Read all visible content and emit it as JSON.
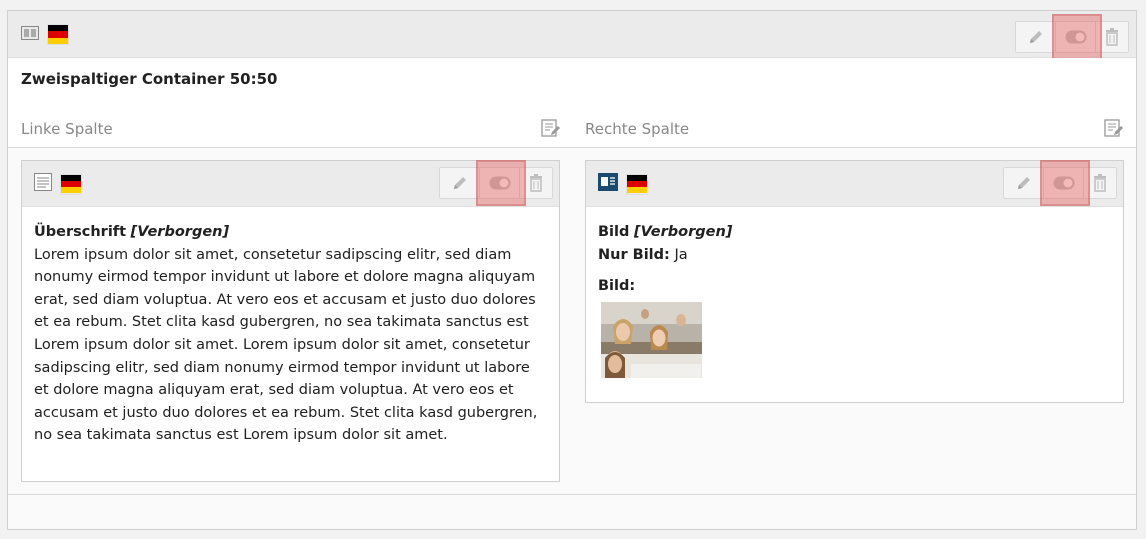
{
  "container": {
    "title": "Zweispaltiger Container 50:50",
    "left_column_label": "Linke Spalte",
    "right_column_label": "Rechte Spalte"
  },
  "left_element": {
    "heading": "Überschrift",
    "hidden_tag": "[Verborgen]",
    "text": "Lorem ipsum dolor sit amet, consetetur sadipscing elitr, sed diam nonumy eirmod tempor invidunt ut labore et dolore magna aliquyam erat, sed diam voluptua. At vero eos et accusam et justo duo dolores et ea rebum. Stet clita kasd gubergren, no sea takimata sanctus est Lorem ipsum dolor sit amet. Lorem ipsum dolor sit amet, consetetur sadipscing elitr, sed diam nonumy eirmod tempor invidunt ut labore et dolore magna aliquyam erat, sed diam voluptua. At vero eos et accusam et justo duo dolores et ea rebum. Stet clita kasd gubergren, no sea takimata sanctus est Lorem ipsum dolor sit amet."
  },
  "right_element": {
    "heading": "Bild",
    "hidden_tag": "[Verborgen]",
    "only_image_label": "Nur Bild:",
    "only_image_value": "Ja",
    "image_label": "Bild:"
  },
  "icons": {
    "container": "grid-container-icon",
    "language": "german-flag-icon",
    "edit": "pencil-icon",
    "toggle": "toggle-visibility-icon",
    "delete": "trash-icon",
    "column_edit": "edit-column-icon",
    "text_element": "text-content-icon",
    "image_element": "text-image-content-icon"
  },
  "colors": {
    "highlight": "#e66464",
    "flag_black": "#000000",
    "flag_red": "#dd0000",
    "flag_gold": "#ffce00"
  }
}
